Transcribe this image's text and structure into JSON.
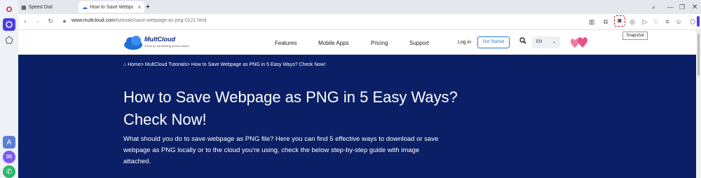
{
  "browser": {
    "tabs": [
      {
        "label": "Speed Dial",
        "icon": "grid-icon"
      },
      {
        "label": "How to Save Webpage as",
        "icon": "cloud-icon"
      }
    ],
    "new_tab_label": "+",
    "url_prefix": "www.multcloud.com",
    "url_path": "/tutorials/save-webpage-as-png-0121.html",
    "tooltip": "Snapshot",
    "accent": "#e0101c"
  },
  "site": {
    "logo_name": "MultCloud",
    "logo_tagline": "Focus on transferring across clouds",
    "nav": [
      "Features",
      "Mobile Apps",
      "Pricing",
      "Support"
    ],
    "login": "Log in",
    "get_started": "Get Started",
    "language": "EN"
  },
  "hero": {
    "breadcrumb_home": "Home>",
    "breadcrumb_rest": "MultCloud Tutorials> How to Save Webpage as PNG in 5 Easy Ways? Check Now!",
    "title": "How to Save Webpage as PNG in 5 Easy Ways? Check Now!",
    "description": "What should you do to save webpage as PNG file? Here you can find 5 effective ways to download or save webpage as PNG locally or to the cloud you're using, check the below step-by-step guide with image attached.",
    "background": "#0a1f66"
  }
}
